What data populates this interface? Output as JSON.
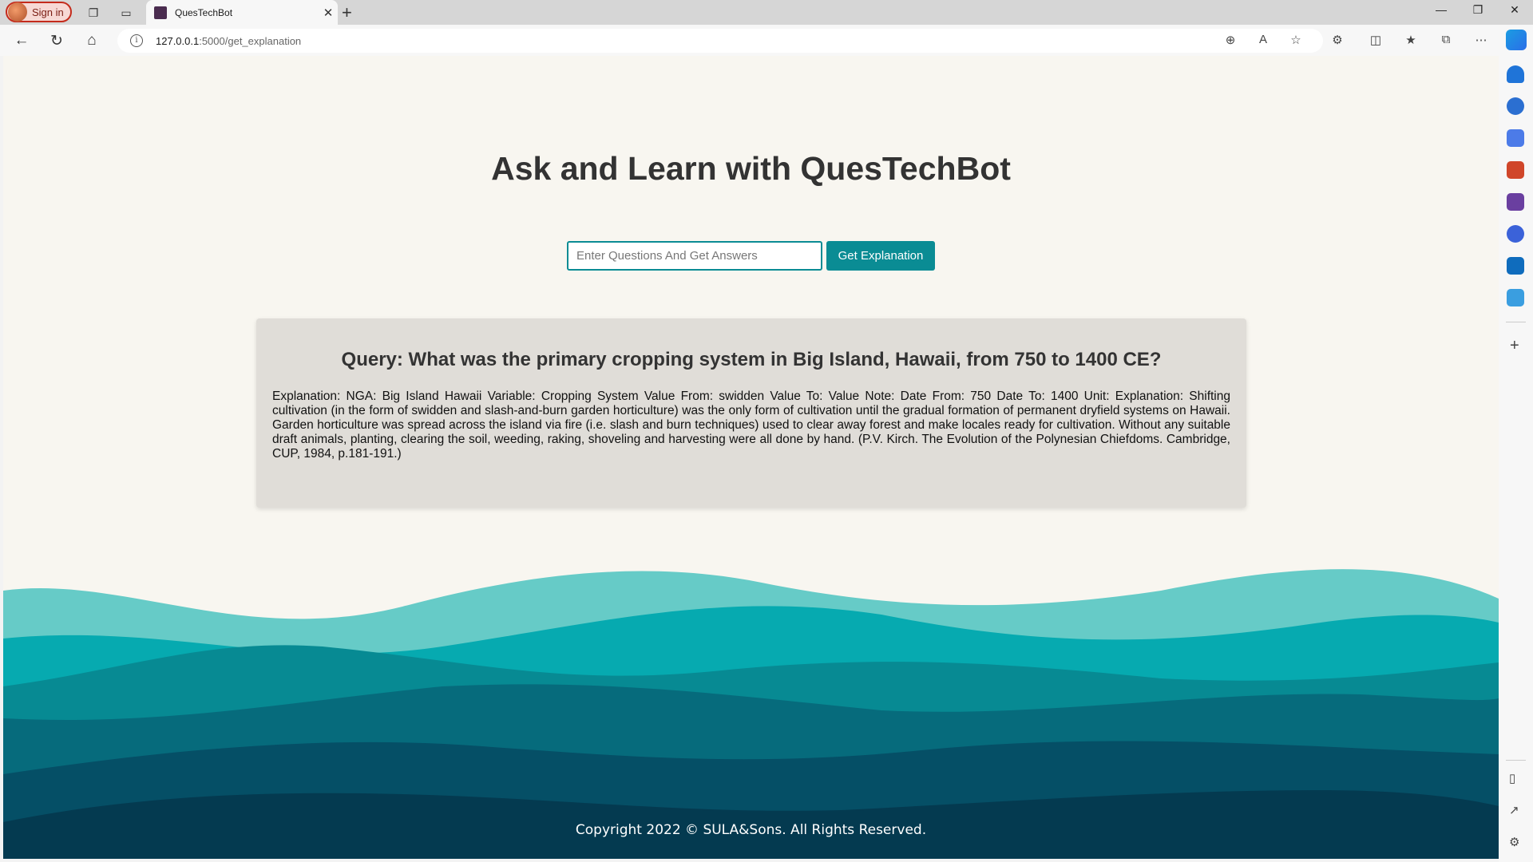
{
  "browser": {
    "signin_label": "Sign in",
    "tab_title": "QuesTechBot",
    "url_host": "127.0.0.1",
    "url_path": ":5000/get_explanation"
  },
  "page": {
    "heading": "Ask and Learn with QuesTechBot",
    "search_placeholder": "Enter Questions And Get Answers",
    "search_value": "",
    "button_label": "Get Explanation",
    "query_heading": "Query: What was the primary cropping system in Big Island, Hawaii, from 750 to 1400 CE?",
    "explanation": "Explanation: NGA: Big Island Hawaii Variable: Cropping System Value From: swidden Value To: Value Note: Date From: 750 Date To: 1400 Unit: Explanation: Shifting cultivation (in the form of swidden and slash-and-burn garden horticulture) was the only form of cultivation until the gradual formation of permanent dryfield systems on Hawaii. Garden horticulture was spread across the island via fire (i.e. slash and burn techniques) used to clear away forest and make locales ready for cultivation. Without any suitable draft animals, planting, clearing the soil, weeding, raking, shoveling and harvesting were all done by hand. (P.V. Kirch. The Evolution of the Polynesian Chiefdoms. Cambridge, CUP, 1984, p.181-191.)",
    "footer": "Copyright 2022 © SULA&Sons. All Rights Reserved."
  },
  "colors": {
    "accent": "#0a8c94",
    "wave1": "#66cbc7",
    "wave2": "#06aab0",
    "wave3": "#078a93",
    "wave4": "#066b7c",
    "wave5": "#054f66",
    "wave6": "#043a50"
  }
}
